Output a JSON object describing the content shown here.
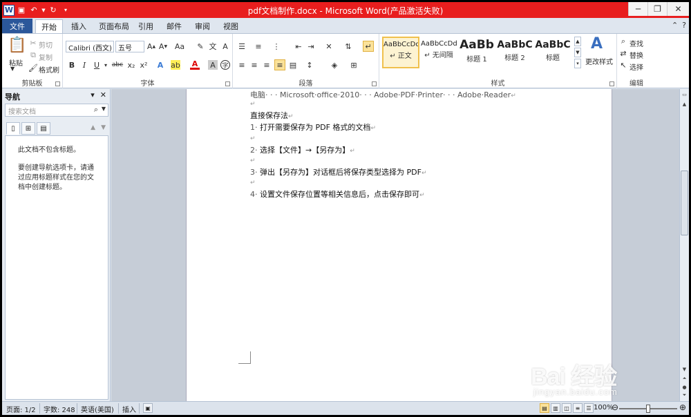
{
  "window": {
    "title": "pdf文档制作.docx - Microsoft Word(产品激活失败)",
    "controls": {
      "minimize": "─",
      "restore": "❐",
      "close": "✕"
    }
  },
  "tabs": {
    "file": "文件",
    "items": [
      "开始",
      "插入",
      "页面布局",
      "引用",
      "邮件",
      "审阅",
      "视图"
    ],
    "active": "开始"
  },
  "ribbon": {
    "clipboard": {
      "label": "剪贴板",
      "paste": "粘贴",
      "cut": "剪切",
      "copy": "复制",
      "format_painter": "格式刷"
    },
    "font": {
      "label": "字体",
      "font_name": "Calibri (西文)",
      "font_size": "五号",
      "bold": "B",
      "italic": "I",
      "underline": "U",
      "strike": "abc",
      "sub": "x₂",
      "sup": "x²",
      "case": "Aa"
    },
    "paragraph": {
      "label": "段落"
    },
    "styles": {
      "label": "样式",
      "items": [
        {
          "preview": "AaBbCcDd",
          "name": "↵ 正文"
        },
        {
          "preview": "AaBbCcDd",
          "name": "↵ 无间隔"
        },
        {
          "preview": "AaBb",
          "name": "标题 1"
        },
        {
          "preview": "AaBbC",
          "name": "标题 2"
        },
        {
          "preview": "AaBbC",
          "name": "标题"
        }
      ],
      "change_styles": "更改样式"
    },
    "editing": {
      "label": "编辑",
      "find": "查找",
      "replace": "替换",
      "select": "选择"
    }
  },
  "nav": {
    "title": "导航",
    "search_placeholder": "搜索文档",
    "msg1": "此文档不包含标题。",
    "msg2": "要创建导航选项卡，请通过应用标题样式在您的文档中创建标题。"
  },
  "document": {
    "line0": "电脑· · · Microsoft·office·2010· · · Adobe·PDF·Printer· · · Adobe·Reader",
    "heading": "直接保存法",
    "steps": [
      {
        "num": "1·",
        "text": "打开需要保存为 PDF 格式的文档"
      },
      {
        "num": "2·",
        "text": "选择【文件】→【另存为】"
      },
      {
        "num": "3·",
        "text": "弹出【另存为】对话框后将保存类型选择为 PDF"
      },
      {
        "num": "4·",
        "text": "设置文件保存位置等相关信息后，点击保存即可"
      }
    ]
  },
  "status": {
    "page": "页面: 1/2",
    "words": "字数: 248",
    "language": "英语(美国)",
    "mode": "插入",
    "zoom": "100%"
  },
  "watermark": {
    "brand": "Bai 经验",
    "url": "jingyan.baidu.com"
  }
}
